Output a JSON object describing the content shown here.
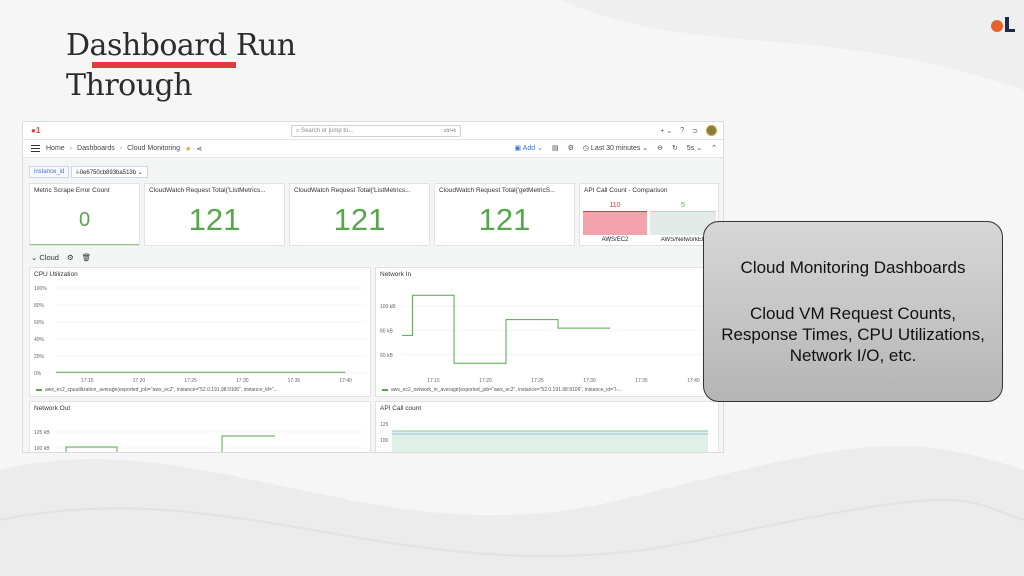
{
  "slide": {
    "title_line1": "Dashboard Run",
    "title_line2": "Through",
    "accent_color": "#e23b3b"
  },
  "callout": {
    "title": "Cloud Monitoring Dashboards",
    "body": "Cloud VM Request Counts, Response Times, CPU Utilizations, Network I/O, etc."
  },
  "grafana": {
    "search_placeholder": "Search or jump to...",
    "search_shortcut": "ctrl+k",
    "breadcrumb": [
      "Home",
      "Dashboards",
      "Cloud Monitoring"
    ],
    "add_label": "Add",
    "time_range": "Last 30 minutes",
    "refresh_interval": "5s",
    "variable": {
      "label": "instance_id",
      "value": "i-0e6750cb893ba513b"
    },
    "row_title": "Cloud",
    "stat_panels": [
      {
        "title": "Metric Scrape Error Count",
        "value": "0"
      },
      {
        "title": "CloudWatch Request Total{'ListMetrics...",
        "value": "121"
      },
      {
        "title": "CloudWatch Request Total{'ListMetrics...",
        "value": "121"
      },
      {
        "title": "CloudWatch Request Total{'getMetricS...",
        "value": "121"
      }
    ],
    "api_compare": {
      "title": "API Call Count - Comparison",
      "bars": [
        {
          "label": "AWS/EC2",
          "value": 110,
          "color": "#f2a3ad",
          "text_color": "#d4374a"
        },
        {
          "label": "AWS/NetworkEL",
          "value": 5,
          "color": "#e3ebe8",
          "text_color": "#56a64b"
        }
      ]
    },
    "cpu_panel": {
      "title": "CPU Utilization",
      "y_ticks": [
        "100%",
        "80%",
        "60%",
        "40%",
        "20%",
        "0%"
      ],
      "x_ticks": [
        "17:15",
        "17:20",
        "17:25",
        "17:30",
        "17:35",
        "17:40"
      ],
      "legend": "aws_ec2_cpuutilization_average{exported_job=\"aws_ec2\", instance=\"52.0.191.98:9106\", instance_id=\"..."
    },
    "network_in_panel": {
      "title": "Network In",
      "y_ticks": [
        "100 kB",
        "80 kB",
        "60 kB"
      ],
      "x_ticks": [
        "17:15",
        "17:20",
        "17:25",
        "17:30",
        "17:35",
        "17:40"
      ],
      "legend": "aws_ec2_network_in_average{exported_job=\"aws_ec2\", instance=\"52.0.191.98:9106\", instance_id=\"i-..."
    },
    "network_out_panel": {
      "title": "Network Out",
      "y_ticks": [
        "125 kB",
        "100 kB"
      ]
    },
    "api_call_panel": {
      "title": "API Call count",
      "y_ticks": [
        "125",
        "100"
      ]
    },
    "series_color": "#56a64b"
  },
  "chart_data": [
    {
      "type": "line",
      "title": "CPU Utilization",
      "x": [
        "17:12",
        "17:40"
      ],
      "values": [
        1,
        1
      ],
      "ylim": [
        0,
        100
      ]
    },
    {
      "type": "line",
      "title": "Network In",
      "x": [
        "17:12",
        "17:13",
        "17:13",
        "17:17",
        "17:17",
        "17:22",
        "17:22",
        "17:27",
        "17:27",
        "17:32"
      ],
      "values": [
        76,
        76,
        109,
        109,
        53,
        53,
        89,
        89,
        82,
        82
      ]
    }
  ]
}
